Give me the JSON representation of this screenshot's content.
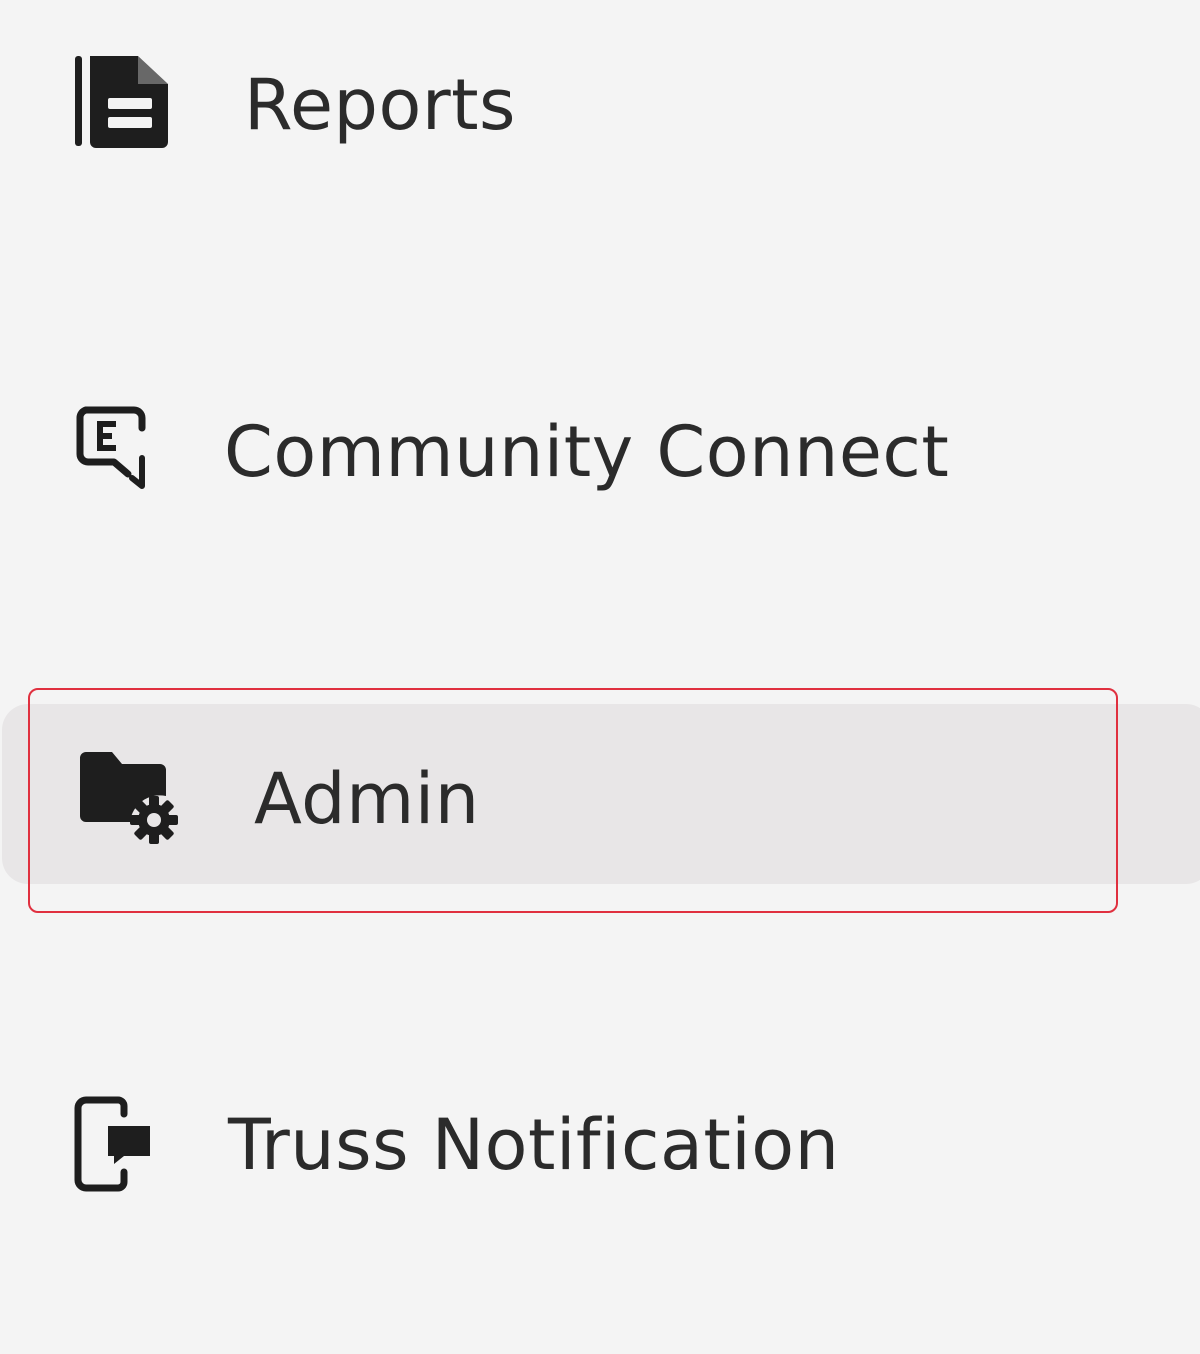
{
  "sidebar": {
    "items": [
      {
        "label": "Reports",
        "icon": "report-document-icon",
        "selected": false
      },
      {
        "label": "Community Connect",
        "icon": "community-chat-icon",
        "selected": false
      },
      {
        "label": "Admin",
        "icon": "folder-gear-icon",
        "selected": true
      },
      {
        "label": "Truss Notification",
        "icon": "mobile-notification-icon",
        "selected": false
      }
    ]
  },
  "colors": {
    "background": "#f4f4f4",
    "selected_background": "#e8e6e7",
    "highlight_border": "#e0303f",
    "text": "#2b2b2b",
    "icon": "#1e1e1e"
  }
}
